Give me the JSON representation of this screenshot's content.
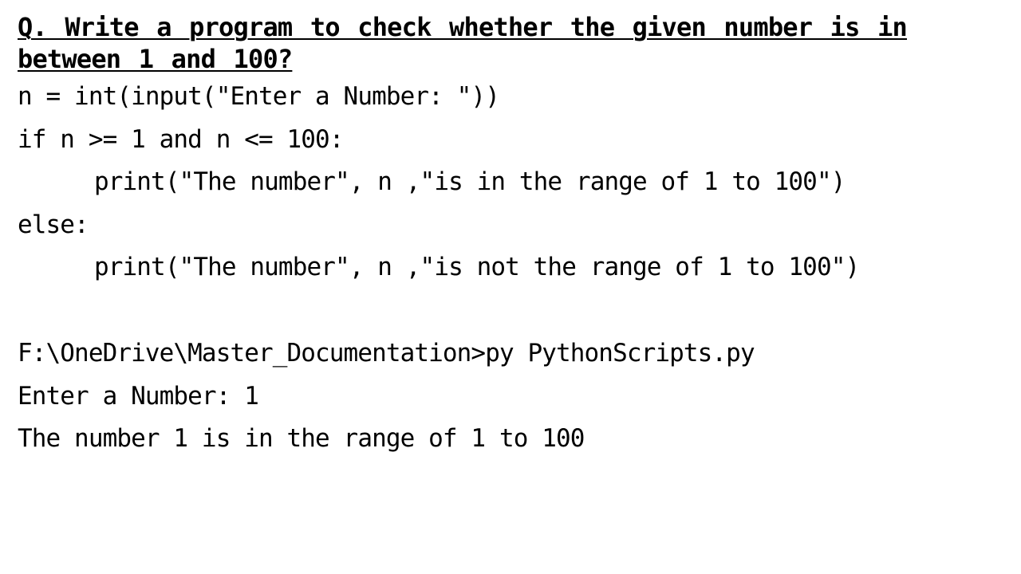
{
  "question": "Q. Write a program to check whether the given number is in between 1 and 100?",
  "code": [
    "n = int(input(\"Enter a Number: \"))",
    "if n >= 1 and n <= 100:",
    "print(\"The number\", n ,\"is in the range of 1 to 100\")",
    "else:",
    "print(\"The number\", n ,\"is not the range of 1 to 100\")"
  ],
  "output": [
    "F:\\OneDrive\\Master_Documentation>py PythonScripts.py",
    "Enter a Number: 1",
    "The number 1 is in the range of 1 to 100"
  ]
}
